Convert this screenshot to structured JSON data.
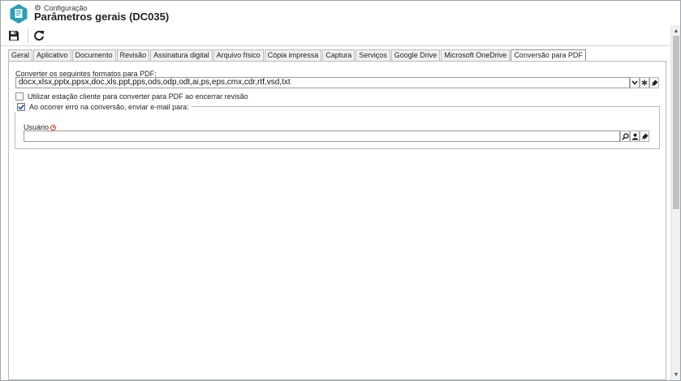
{
  "header": {
    "breadcrumb": "Configuração",
    "title": "Parâmetros gerais (DC035)",
    "icon": "document-settings-icon",
    "accent_color": "#2b9fb8"
  },
  "toolbar": {
    "save_icon": "floppy-disk-icon",
    "refresh_icon": "refresh-icon"
  },
  "tabs": [
    {
      "label": "Geral"
    },
    {
      "label": "Aplicativo"
    },
    {
      "label": "Documento"
    },
    {
      "label": "Revisão"
    },
    {
      "label": "Assinatura digital"
    },
    {
      "label": "Arquivo físico"
    },
    {
      "label": "Cópia impressa"
    },
    {
      "label": "Captura"
    },
    {
      "label": "Serviços"
    },
    {
      "label": "Google Drive"
    },
    {
      "label": "Microsoft OneDrive"
    },
    {
      "label": "Conversão para PDF"
    }
  ],
  "active_tab": "Conversão para PDF",
  "form": {
    "formats_label": "Converter os seguintes formatos para PDF:",
    "formats_value": "docx,xlsx,pptx,ppsx,doc,xls,ppt,pps,ods,odp,odt,ai,ps,eps,cmx,cdr,rtf,vsd,txt",
    "client_station_label": "Utilizar estação cliente para converter para PDF ao encerrar revisão",
    "client_station_checked": false,
    "error_email_label": "Ao ocorrer erro na conversão, enviar e-mail para:",
    "error_email_checked": true,
    "user_label": "Usuário",
    "user_value": ""
  },
  "colors": {
    "required": "#e2321b",
    "check": "#1a5fb4"
  }
}
